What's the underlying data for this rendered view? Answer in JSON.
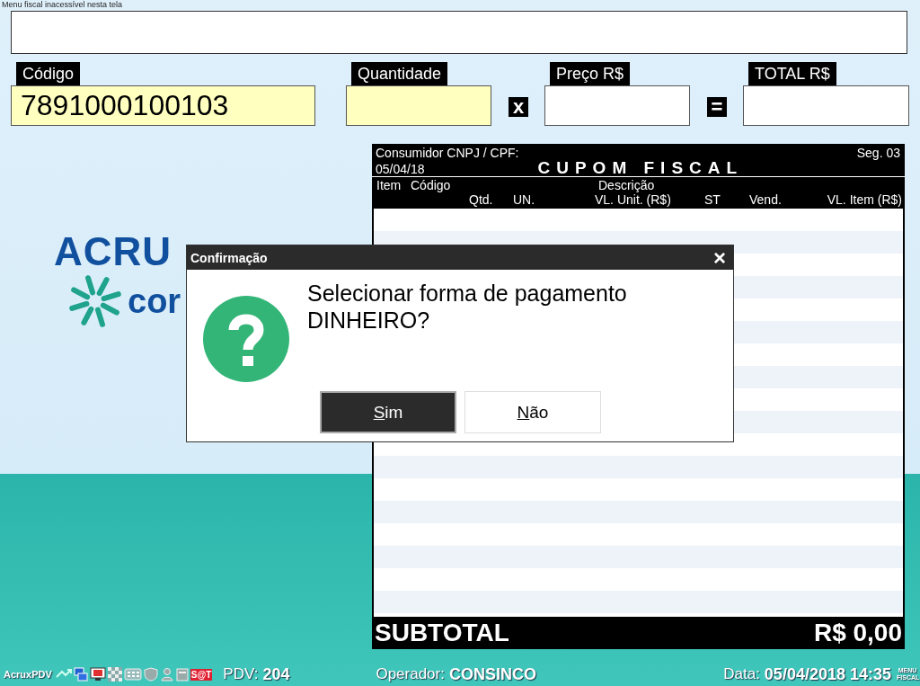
{
  "top_notice": "Menu fiscal inacessível nesta tela",
  "entry": [
    {
      "kind": "field",
      "label": "Código",
      "value": "7891000100103",
      "highlighted": true
    },
    {
      "kind": "field",
      "label": "Quantidade",
      "highlighted": true
    },
    {
      "kind": "operator",
      "symbol": "x"
    },
    {
      "kind": "field",
      "label": "Preço R$",
      "highlighted": false
    },
    {
      "kind": "operator",
      "symbol": "="
    },
    {
      "kind": "field",
      "label": "TOTAL R$",
      "highlighted": false
    }
  ],
  "logo": {
    "brand": "ACRU",
    "partner": "cor"
  },
  "receipt": {
    "consumer_label": "Consumidor CNPJ / CPF:",
    "segment": "Seg. 03",
    "date": "05/04/18",
    "title": "CUPOM FISCAL",
    "columns_row_1": [
      "Item",
      "Código",
      "Descrição"
    ],
    "columns_row_2": [
      "Qtd.",
      "UN.",
      "VL. Unit. (R$)",
      "ST",
      "Vend.",
      "VL. Item (R$)"
    ],
    "subtotal_label": "SUBTOTAL",
    "subtotal_value": "R$ 0,00"
  },
  "dialog": {
    "title": "Confirmação",
    "close": "×",
    "message": "Selecionar forma de pagamento DINHEIRO?",
    "buttons": [
      {
        "label": "Sim",
        "selected": true
      },
      {
        "label": "Não",
        "selected": false
      }
    ]
  },
  "status_bar": {
    "app": "AcruxPDV",
    "sat_badge": "S@T",
    "pdv_label": "PDV:",
    "pdv": "204",
    "operator_label": "Operador:",
    "operator": "CONSINCO",
    "date_label": "Data:",
    "date": "05/04/2018 14:35",
    "menu_label": "MENU FISCAL"
  }
}
